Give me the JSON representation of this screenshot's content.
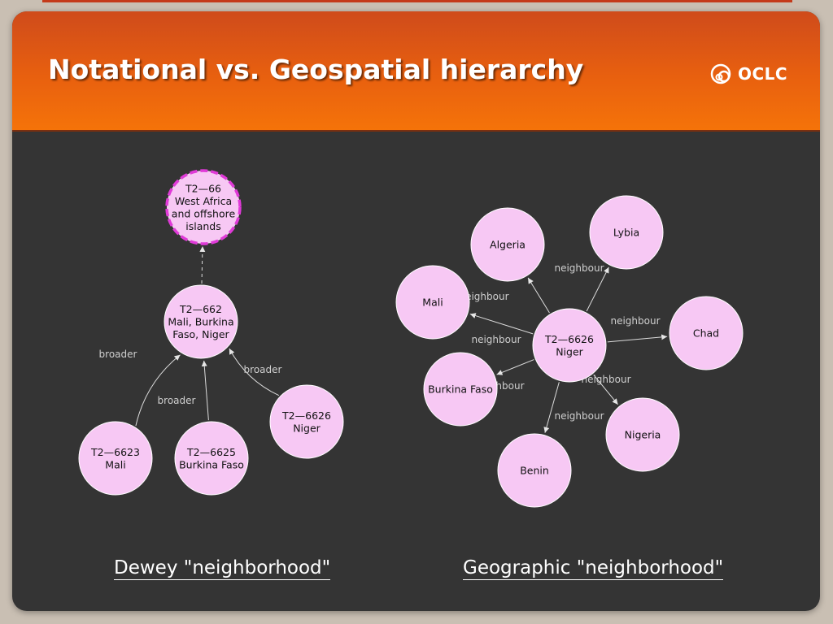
{
  "header": {
    "title": "Notational vs. Geospatial hierarchy",
    "logo_text": "OCLC"
  },
  "colors": {
    "header_top": "#cf4b1b",
    "header_bottom": "#f57309",
    "node_fill": "#f7c8f4",
    "node_highlight": "#e03ad8",
    "background": "#343434"
  },
  "dewey": {
    "caption": "Dewey \"neighborhood\"",
    "nodes": [
      {
        "id": "west-africa",
        "lines": [
          "T2—66",
          "West Africa",
          "and offshore",
          "islands"
        ],
        "highlighted": true
      },
      {
        "id": "t2-662",
        "lines": [
          "T2—662",
          "Mali, Burkina",
          "Faso, Niger"
        ]
      },
      {
        "id": "t2-6623",
        "lines": [
          "T2—6623",
          "Mali"
        ]
      },
      {
        "id": "t2-6625",
        "lines": [
          "T2—6625",
          "Burkina Faso"
        ]
      },
      {
        "id": "t2-6626",
        "lines": [
          "T2—6626",
          "Niger"
        ]
      }
    ],
    "edges": [
      {
        "from": "t2-662",
        "to": "west-africa",
        "label": "",
        "style": "dashed"
      },
      {
        "from": "t2-6623",
        "to": "t2-662",
        "label": "broader"
      },
      {
        "from": "t2-6625",
        "to": "t2-662",
        "label": "broader"
      },
      {
        "from": "t2-6626",
        "to": "t2-662",
        "label": "broader"
      }
    ]
  },
  "geo": {
    "caption": "Geographic \"neighborhood\"",
    "nodes": [
      {
        "id": "niger",
        "lines": [
          "T2—6626",
          "Niger"
        ]
      },
      {
        "id": "algeria",
        "lines": [
          "Algeria"
        ]
      },
      {
        "id": "lybia",
        "lines": [
          "Lybia"
        ]
      },
      {
        "id": "mali",
        "lines": [
          "Mali"
        ]
      },
      {
        "id": "chad",
        "lines": [
          "Chad"
        ]
      },
      {
        "id": "burkina-faso",
        "lines": [
          "Burkina Faso"
        ]
      },
      {
        "id": "nigeria",
        "lines": [
          "Nigeria"
        ]
      },
      {
        "id": "benin",
        "lines": [
          "Benin"
        ]
      }
    ],
    "edges": [
      {
        "from": "niger",
        "to": "algeria",
        "label": "neighbour"
      },
      {
        "from": "niger",
        "to": "lybia",
        "label": "neighbour"
      },
      {
        "from": "niger",
        "to": "mali",
        "label": "neighbour"
      },
      {
        "from": "niger",
        "to": "chad",
        "label": "neighbour"
      },
      {
        "from": "niger",
        "to": "burkina-faso",
        "label": "neighbour"
      },
      {
        "from": "niger",
        "to": "nigeria",
        "label": "neighbour"
      },
      {
        "from": "niger",
        "to": "benin",
        "label": "neighbour"
      }
    ]
  }
}
